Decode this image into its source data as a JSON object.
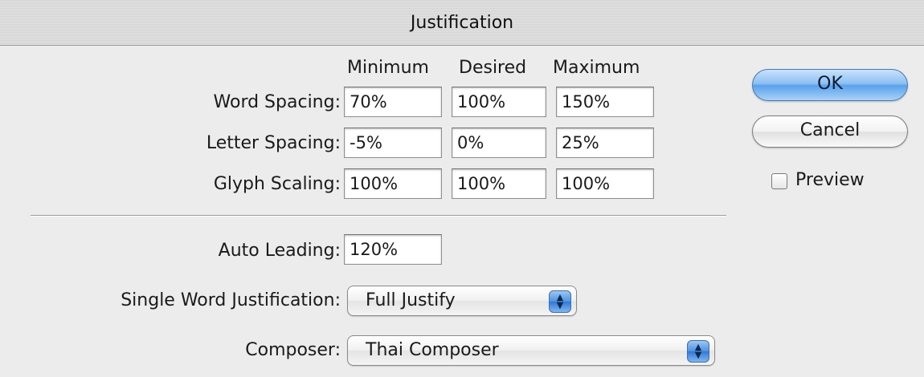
{
  "window": {
    "title": "Justification"
  },
  "columns": {
    "minimum": "Minimum",
    "desired": "Desired",
    "maximum": "Maximum"
  },
  "rows": {
    "word_spacing": {
      "label": "Word Spacing:",
      "min": "70%",
      "desired": "100%",
      "max": "150%"
    },
    "letter_spacing": {
      "label": "Letter Spacing:",
      "min": "-5%",
      "desired": "0%",
      "max": "25%"
    },
    "glyph_scaling": {
      "label": "Glyph Scaling:",
      "min": "100%",
      "desired": "100%",
      "max": "100%"
    }
  },
  "auto_leading": {
    "label": "Auto Leading:",
    "value": "120%"
  },
  "single_word": {
    "label": "Single Word Justification:",
    "value": "Full Justify"
  },
  "composer": {
    "label": "Composer:",
    "value": "Thai Composer"
  },
  "buttons": {
    "ok": "OK",
    "cancel": "Cancel"
  },
  "preview": {
    "label": "Preview",
    "checked": false
  },
  "colors": {
    "default_button": "#5aa2ec",
    "popup_arrows": "#2f78d8"
  }
}
